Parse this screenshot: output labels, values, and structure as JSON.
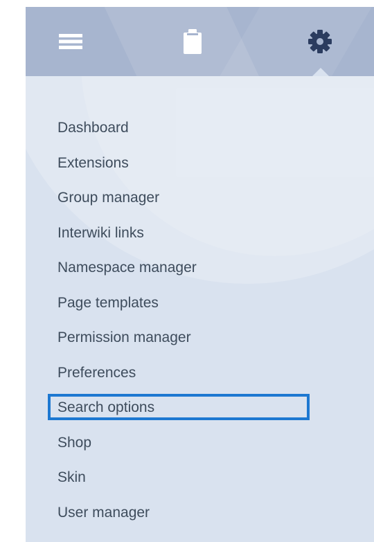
{
  "topbar": {
    "tabs": [
      {
        "icon": "hamburger-menu-icon"
      },
      {
        "icon": "clipboard-icon"
      },
      {
        "icon": "gear-icon",
        "active": true
      }
    ],
    "background": "#a7b5cf",
    "icon_color_inactive": "#ffffff",
    "icon_color_active": "#2b3c5f"
  },
  "panel": {
    "background": "#d9e2ef"
  },
  "menu": {
    "selected_index": 8,
    "highlight_color": "#1d78d1",
    "items": [
      {
        "label": "Dashboard"
      },
      {
        "label": "Extensions"
      },
      {
        "label": "Group manager"
      },
      {
        "label": "Interwiki links"
      },
      {
        "label": "Namespace manager"
      },
      {
        "label": "Page templates"
      },
      {
        "label": "Permission manager"
      },
      {
        "label": "Preferences"
      },
      {
        "label": "Search options"
      },
      {
        "label": "Shop"
      },
      {
        "label": "Skin"
      },
      {
        "label": "User manager"
      }
    ]
  }
}
